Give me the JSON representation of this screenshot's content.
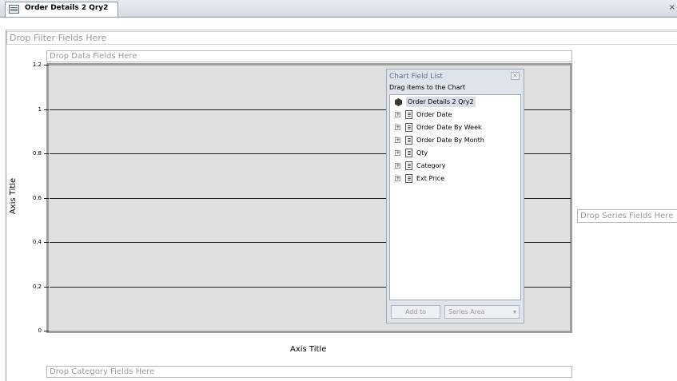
{
  "tab": {
    "title": "Order Details 2 Qry2",
    "icon": "query-icon"
  },
  "drop_zones": {
    "filter": "Drop Filter Fields Here",
    "data": "Drop Data Fields Here",
    "series": "Drop Series Fields Here",
    "category": "Drop Category Fields Here"
  },
  "axes": {
    "y_title": "Axis Title",
    "x_title": "Axis Title",
    "y_ticks": [
      "1.2",
      "1",
      "0.8",
      "0.6",
      "0.4",
      "0.2",
      "0"
    ]
  },
  "chart_data": {
    "type": "bar",
    "title": "",
    "xlabel": "Axis Title",
    "ylabel": "Axis Title",
    "ylim": [
      0,
      1.2
    ],
    "yticks": [
      0,
      0.2,
      0.4,
      0.6,
      0.8,
      1,
      1.2
    ],
    "categories": [],
    "series": [],
    "grid": true
  },
  "field_list": {
    "title": "Chart Field List",
    "subtitle": "Drag items to the Chart",
    "root": "Order Details 2 Qry2",
    "fields": [
      "Order Date",
      "Order Date By Week",
      "Order Date By Month",
      "Qty",
      "Category",
      "Ext Price"
    ],
    "add_to_label": "Add to",
    "area_value": "Series Area"
  },
  "colors": {
    "plot_bg": "#e0e0e0",
    "gridline": "#1f1f1f",
    "panel_bg": "#dfe3ea",
    "placeholder_text": "#9a9a9a"
  }
}
